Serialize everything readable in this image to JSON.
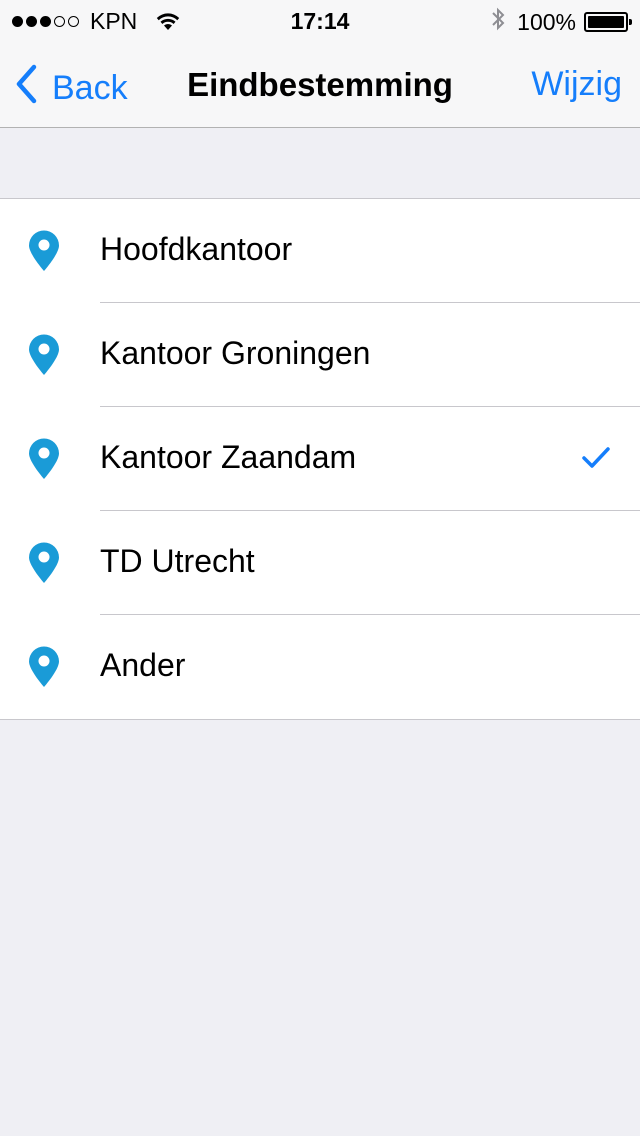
{
  "status_bar": {
    "carrier": "KPN",
    "time": "17:14",
    "battery": "100%",
    "signal_bars_filled": 3,
    "signal_bars_total": 5
  },
  "nav": {
    "back_label": "Back",
    "title": "Eindbestemming",
    "edit_label": "Wijzig"
  },
  "destinations": [
    {
      "label": "Hoofdkantoor",
      "selected": false
    },
    {
      "label": "Kantoor Groningen",
      "selected": false
    },
    {
      "label": "Kantoor Zaandam",
      "selected": true
    },
    {
      "label": "TD Utrecht",
      "selected": false
    },
    {
      "label": "Ander",
      "selected": false
    }
  ],
  "colors": {
    "tint": "#157efb",
    "pin": "#1a9bd7",
    "background": "#efeff4"
  },
  "icons": {
    "back": "chevron-left-icon",
    "pin": "location-pin-icon",
    "check": "checkmark-icon"
  }
}
